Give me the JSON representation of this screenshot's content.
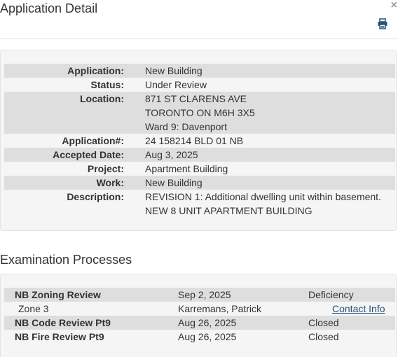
{
  "header": {
    "title": "Application Detail",
    "close_glyph": "×",
    "print_icon": "printer-icon"
  },
  "detail": {
    "application": {
      "label": "Application:",
      "value": "New Building"
    },
    "status": {
      "label": "Status:",
      "value": "Under Review"
    },
    "location": {
      "label": "Location:",
      "lines": [
        "871 ST CLARENS AVE",
        "TORONTO ON M6H 3X5",
        "Ward 9: Davenport"
      ]
    },
    "application_number": {
      "label": "Application#:",
      "value": "24 158214 BLD 01 NB"
    },
    "accepted_date": {
      "label": "Accepted Date:",
      "value": "Aug 3, 2025"
    },
    "project": {
      "label": "Project:",
      "value": "Apartment Building"
    },
    "work": {
      "label": "Work:",
      "value": "New Building"
    },
    "description": {
      "label": "Description:",
      "lines": [
        "REVISION 1: Additional dwelling unit within basement.",
        "NEW 8 UNIT APARTMENT BUILDING"
      ]
    }
  },
  "examination": {
    "title": "Examination Processes",
    "rows": [
      {
        "name": "NB Zoning Review",
        "date": "Sep 2, 2025",
        "status": "Deficiency"
      },
      {
        "name": "Zone 3",
        "date": "Karremans, Patrick",
        "link": "Contact Info"
      },
      {
        "name": "NB Code Review Pt9",
        "date": "Aug 26, 2025",
        "status": "Closed"
      },
      {
        "name": "NB Fire Review Pt9",
        "date": "Aug 26, 2025",
        "status": "Closed"
      }
    ]
  },
  "colors": {
    "panel_bg": "#f5f5f5",
    "row_shade": "#dedede",
    "link": "#23527c",
    "text": "#333333"
  }
}
